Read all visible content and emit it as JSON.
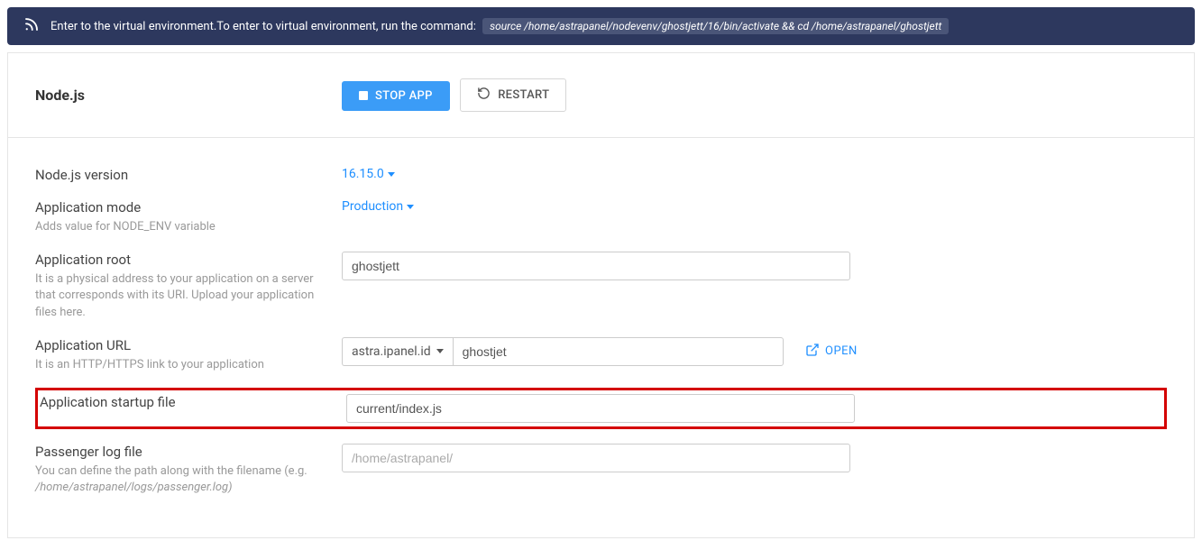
{
  "banner": {
    "prefix": "Enter to the virtual environment.To enter to virtual environment, run the command:",
    "command": "source /home/astrapanel/nodevenv/ghostjett/16/bin/activate && cd /home/astrapanel/ghostjett"
  },
  "header": {
    "title": "Node.js",
    "stop_label": "STOP APP",
    "restart_label": "RESTART"
  },
  "form": {
    "version": {
      "label": "Node.js version",
      "value": "16.15.0"
    },
    "mode": {
      "label": "Application mode",
      "help": "Adds value for NODE_ENV variable",
      "value": "Production"
    },
    "root": {
      "label": "Application root",
      "help": "It is a physical address to your application on a server that corresponds with its URI. Upload your application files here.",
      "value": "ghostjett"
    },
    "url": {
      "label": "Application URL",
      "help": "It is an HTTP/HTTPS link to your application",
      "domain": "astra.ipanel.id",
      "path": "ghostjet",
      "open_label": "OPEN"
    },
    "startup": {
      "label": "Application startup file",
      "value": "current/index.js"
    },
    "log": {
      "label": "Passenger log file",
      "help": "You can define the path along with the filename (e.g.",
      "help_example": "/home/astrapanel/logs/passenger.log)",
      "placeholder": "/home/astrapanel/"
    }
  }
}
